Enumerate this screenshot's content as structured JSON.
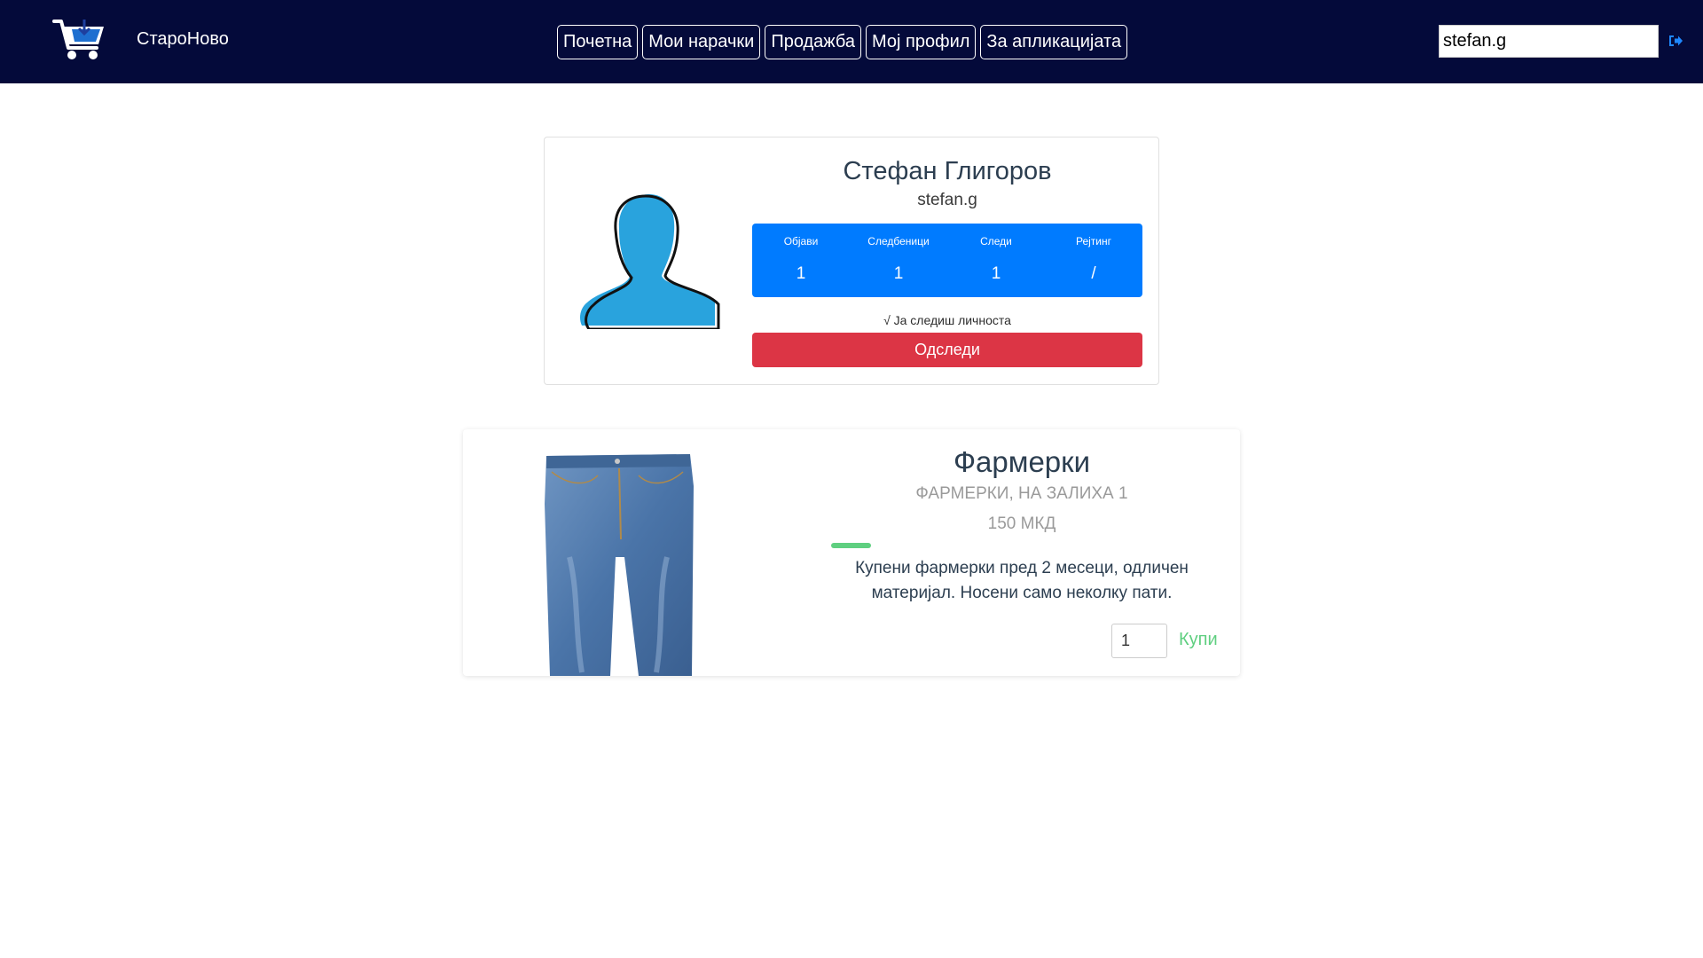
{
  "colors": {
    "navbar_bg": "#040a3a",
    "stats_bg": "#007bff",
    "unfollow_bg": "#dc3545",
    "accent_green": "#5fcf80",
    "avatar_fill": "#29a3dd"
  },
  "navbar": {
    "brand": "СтароНово",
    "logo_icon": "shopping-cart-icon",
    "links": [
      "Почетна",
      "Мои нарачки",
      "Продажба",
      "Мој профил",
      "За апликацијата"
    ],
    "user_field_value": "stefan.g",
    "logout_icon": "sign-out-icon"
  },
  "profile": {
    "avatar_icon": "user-silhouette-icon",
    "full_name": "Стефан Глигоров",
    "username": "stefan.g",
    "stats": [
      {
        "label": "Објави",
        "value": "1"
      },
      {
        "label": "Следбеници",
        "value": "1"
      },
      {
        "label": "Следи",
        "value": "1"
      },
      {
        "label": "Рејтинг",
        "value": "/"
      }
    ],
    "follow_status": "√ Ја следиш личноста",
    "unfollow_label": "Одследи"
  },
  "product": {
    "image": "jeans-image",
    "title": "Фармерки",
    "subtitle": "ФАРМЕРКИ, НА ЗАЛИХА 1",
    "price": "150 МКД",
    "description": "Купени фармерки пред 2 месеци, одличен материјал. Носени само неколку пати.",
    "quantity": "1",
    "buy_label": "Купи"
  }
}
